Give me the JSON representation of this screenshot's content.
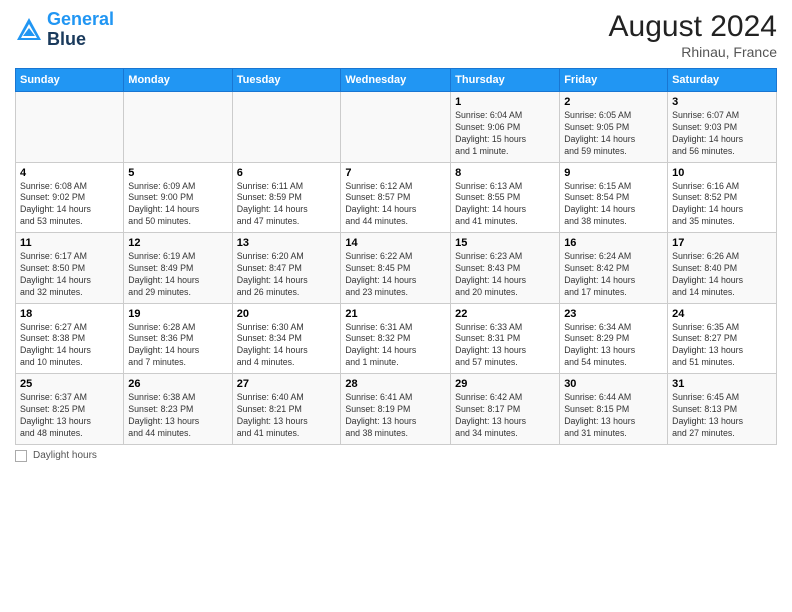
{
  "header": {
    "logo_line1": "General",
    "logo_line2": "Blue",
    "month_year": "August 2024",
    "location": "Rhinau, France"
  },
  "days_of_week": [
    "Sunday",
    "Monday",
    "Tuesday",
    "Wednesday",
    "Thursday",
    "Friday",
    "Saturday"
  ],
  "footer": {
    "note": "Daylight hours"
  },
  "weeks": [
    [
      {
        "day": "",
        "info": ""
      },
      {
        "day": "",
        "info": ""
      },
      {
        "day": "",
        "info": ""
      },
      {
        "day": "",
        "info": ""
      },
      {
        "day": "1",
        "info": "Sunrise: 6:04 AM\nSunset: 9:06 PM\nDaylight: 15 hours\nand 1 minute."
      },
      {
        "day": "2",
        "info": "Sunrise: 6:05 AM\nSunset: 9:05 PM\nDaylight: 14 hours\nand 59 minutes."
      },
      {
        "day": "3",
        "info": "Sunrise: 6:07 AM\nSunset: 9:03 PM\nDaylight: 14 hours\nand 56 minutes."
      }
    ],
    [
      {
        "day": "4",
        "info": "Sunrise: 6:08 AM\nSunset: 9:02 PM\nDaylight: 14 hours\nand 53 minutes."
      },
      {
        "day": "5",
        "info": "Sunrise: 6:09 AM\nSunset: 9:00 PM\nDaylight: 14 hours\nand 50 minutes."
      },
      {
        "day": "6",
        "info": "Sunrise: 6:11 AM\nSunset: 8:59 PM\nDaylight: 14 hours\nand 47 minutes."
      },
      {
        "day": "7",
        "info": "Sunrise: 6:12 AM\nSunset: 8:57 PM\nDaylight: 14 hours\nand 44 minutes."
      },
      {
        "day": "8",
        "info": "Sunrise: 6:13 AM\nSunset: 8:55 PM\nDaylight: 14 hours\nand 41 minutes."
      },
      {
        "day": "9",
        "info": "Sunrise: 6:15 AM\nSunset: 8:54 PM\nDaylight: 14 hours\nand 38 minutes."
      },
      {
        "day": "10",
        "info": "Sunrise: 6:16 AM\nSunset: 8:52 PM\nDaylight: 14 hours\nand 35 minutes."
      }
    ],
    [
      {
        "day": "11",
        "info": "Sunrise: 6:17 AM\nSunset: 8:50 PM\nDaylight: 14 hours\nand 32 minutes."
      },
      {
        "day": "12",
        "info": "Sunrise: 6:19 AM\nSunset: 8:49 PM\nDaylight: 14 hours\nand 29 minutes."
      },
      {
        "day": "13",
        "info": "Sunrise: 6:20 AM\nSunset: 8:47 PM\nDaylight: 14 hours\nand 26 minutes."
      },
      {
        "day": "14",
        "info": "Sunrise: 6:22 AM\nSunset: 8:45 PM\nDaylight: 14 hours\nand 23 minutes."
      },
      {
        "day": "15",
        "info": "Sunrise: 6:23 AM\nSunset: 8:43 PM\nDaylight: 14 hours\nand 20 minutes."
      },
      {
        "day": "16",
        "info": "Sunrise: 6:24 AM\nSunset: 8:42 PM\nDaylight: 14 hours\nand 17 minutes."
      },
      {
        "day": "17",
        "info": "Sunrise: 6:26 AM\nSunset: 8:40 PM\nDaylight: 14 hours\nand 14 minutes."
      }
    ],
    [
      {
        "day": "18",
        "info": "Sunrise: 6:27 AM\nSunset: 8:38 PM\nDaylight: 14 hours\nand 10 minutes."
      },
      {
        "day": "19",
        "info": "Sunrise: 6:28 AM\nSunset: 8:36 PM\nDaylight: 14 hours\nand 7 minutes."
      },
      {
        "day": "20",
        "info": "Sunrise: 6:30 AM\nSunset: 8:34 PM\nDaylight: 14 hours\nand 4 minutes."
      },
      {
        "day": "21",
        "info": "Sunrise: 6:31 AM\nSunset: 8:32 PM\nDaylight: 14 hours\nand 1 minute."
      },
      {
        "day": "22",
        "info": "Sunrise: 6:33 AM\nSunset: 8:31 PM\nDaylight: 13 hours\nand 57 minutes."
      },
      {
        "day": "23",
        "info": "Sunrise: 6:34 AM\nSunset: 8:29 PM\nDaylight: 13 hours\nand 54 minutes."
      },
      {
        "day": "24",
        "info": "Sunrise: 6:35 AM\nSunset: 8:27 PM\nDaylight: 13 hours\nand 51 minutes."
      }
    ],
    [
      {
        "day": "25",
        "info": "Sunrise: 6:37 AM\nSunset: 8:25 PM\nDaylight: 13 hours\nand 48 minutes."
      },
      {
        "day": "26",
        "info": "Sunrise: 6:38 AM\nSunset: 8:23 PM\nDaylight: 13 hours\nand 44 minutes."
      },
      {
        "day": "27",
        "info": "Sunrise: 6:40 AM\nSunset: 8:21 PM\nDaylight: 13 hours\nand 41 minutes."
      },
      {
        "day": "28",
        "info": "Sunrise: 6:41 AM\nSunset: 8:19 PM\nDaylight: 13 hours\nand 38 minutes."
      },
      {
        "day": "29",
        "info": "Sunrise: 6:42 AM\nSunset: 8:17 PM\nDaylight: 13 hours\nand 34 minutes."
      },
      {
        "day": "30",
        "info": "Sunrise: 6:44 AM\nSunset: 8:15 PM\nDaylight: 13 hours\nand 31 minutes."
      },
      {
        "day": "31",
        "info": "Sunrise: 6:45 AM\nSunset: 8:13 PM\nDaylight: 13 hours\nand 27 minutes."
      }
    ]
  ]
}
